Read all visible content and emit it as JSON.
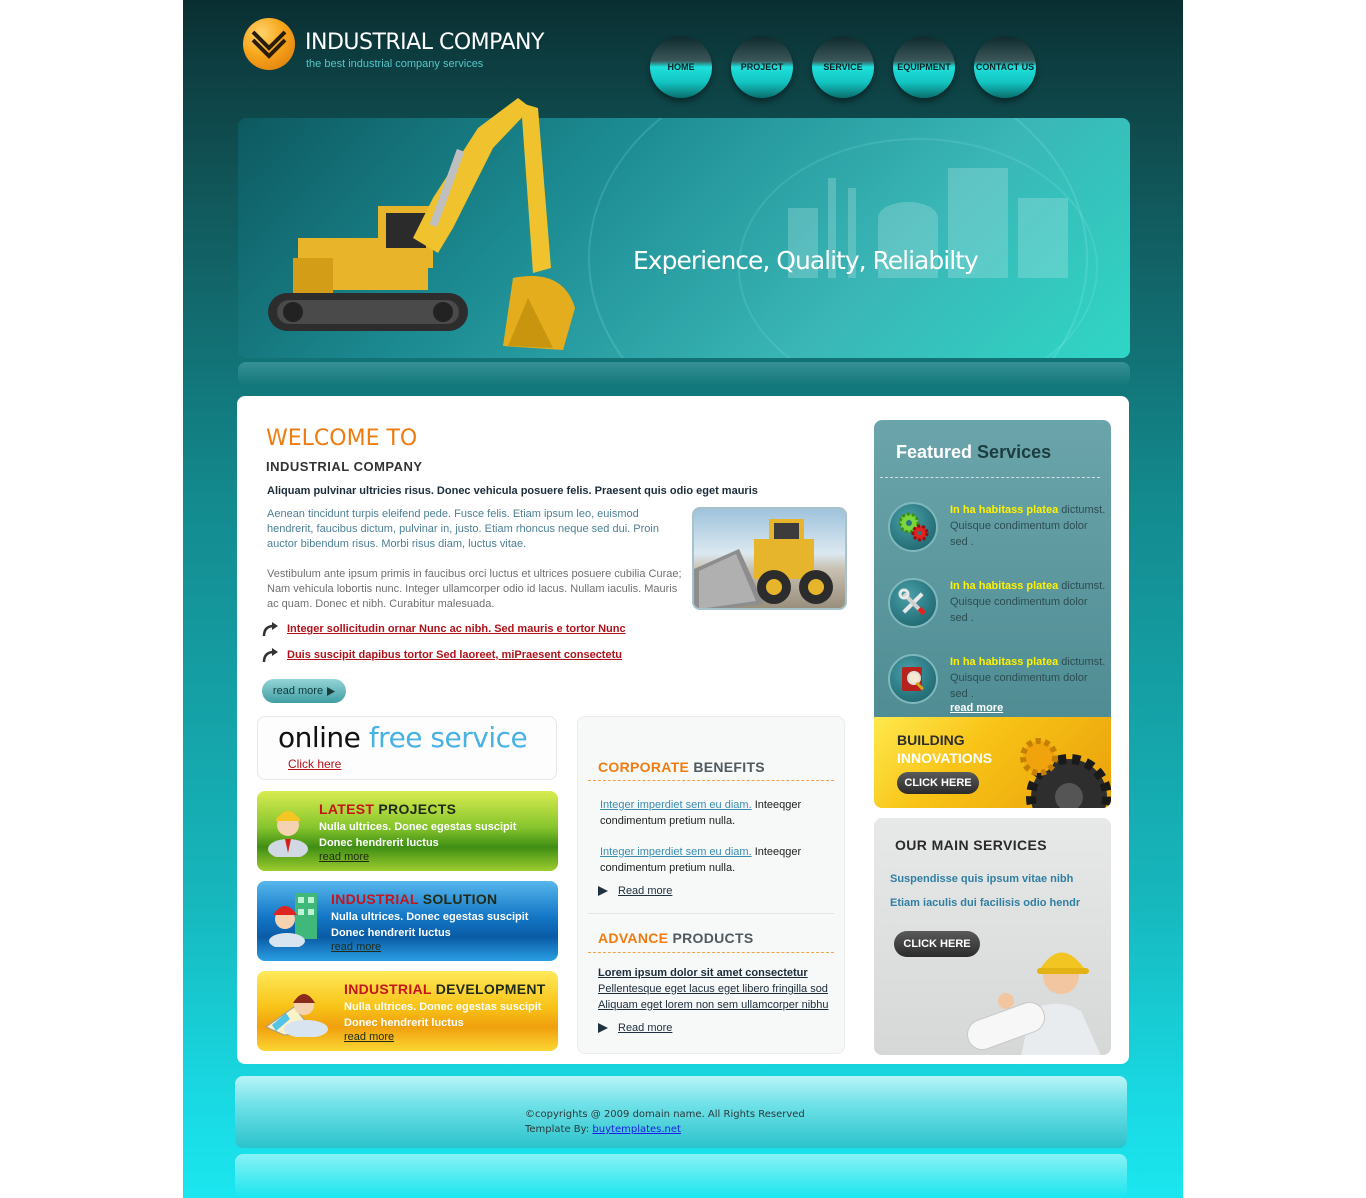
{
  "header": {
    "title": "INDUSTRIAL COMPANY",
    "tagline": "the best industrial  company services"
  },
  "nav": [
    {
      "label": "HOME"
    },
    {
      "label": "PROJECT"
    },
    {
      "label": "SERVICE"
    },
    {
      "label": "EQUIPMENT"
    },
    {
      "label": "CONTACT US"
    }
  ],
  "banner": {
    "slogan": "Experience, Quality, Reliabilty"
  },
  "welcome": {
    "heading": "WELCOME TO",
    "subheading": "INDUSTRIAL COMPANY",
    "intro": "Aliquam pulvinar ultricies risus. Donec vehicula posuere felis. Praesent quis odio eget mauris",
    "para1": "Aenean tincidunt turpis eleifend pede. Fusce felis. Etiam ipsum leo, euismod hendrerit, faucibus dictum, pulvinar in, justo. Etiam rhoncus neque sed dui. Proin auctor bibendum risus. Morbi risus diam, luctus vitae.",
    "para2": "Vestibulum ante ipsum primis in faucibus orci luctus et ultrices posuere cubilia Curae; Nam vehicula lobortis nunc. Integer ullamcorper odio id lacus. Nullam iaculis. Mauris ac quam. Donec et nibh. Curabitur malesuada.",
    "links": [
      "Integer sollicitudin ornar Nunc ac nibh. Sed mauris e tortor Nunc",
      "Duis suscipit dapibus tortor Sed laoreet, miPraesent consectetu"
    ],
    "read_more": "read more"
  },
  "online": {
    "title_dark": "online",
    "title_light": "free service",
    "link": "Click here"
  },
  "promos": [
    {
      "title_red": "LATEST",
      "title_dark": "PROJECTS",
      "line1": "Nulla ultrices. Donec egestas suscipit",
      "line2": "Donec hendrerit luctus",
      "more": "read more"
    },
    {
      "title_red": "INDUSTRIAL",
      "title_dark": "SOLUTION",
      "line1": "Nulla ultrices. Donec egestas suscipit",
      "line2": "Donec hendrerit luctus",
      "more": "read more"
    },
    {
      "title_red": "INDUSTRIAL",
      "title_dark": "DEVELOPMENT",
      "line1": "Nulla ultrices. Donec egestas suscipit",
      "line2": "Donec hendrerit luctus",
      "more": "read more"
    }
  ],
  "corporate": {
    "title_orange": "CORPORATE",
    "title_grey": "BENEFITS",
    "items": [
      {
        "link": "Integer imperdiet sem eu diam.",
        "text": " Inteeqger condimentum pretium nulla."
      },
      {
        "link": "Integer imperdiet sem eu diam.",
        "text": " Inteeqger condimentum pretium nulla."
      }
    ],
    "read_more": "Read more"
  },
  "advance": {
    "title_orange": "ADVANCE",
    "title_grey": "PRODUCTS",
    "lines": [
      "Lorem ipsum dolor sit amet consectetur",
      "Pellentesque eget lacus eget libero fringilla sod",
      "Aliquam eget lorem non sem ullamcorper nibhu"
    ],
    "read_more": "Read more"
  },
  "featured": {
    "title_white": "Featured",
    "title_dark": "Services",
    "items": [
      {
        "highlight": "In ha habitass platea",
        "rest": " dictumst. Quisque condimentum dolor sed .",
        "icon": "gears-icon"
      },
      {
        "highlight": "In ha habitass platea",
        "rest": " dictumst. Quisque condimentum dolor sed .",
        "icon": "tools-icon"
      },
      {
        "highlight": "In ha habitass platea",
        "rest": " dictumst. Quisque condimentum dolor sed .",
        "icon": "book-search-icon"
      }
    ],
    "read_more": "read more"
  },
  "building": {
    "line1": "BUILDING",
    "line2": "INNOVATIONS",
    "button": "CLICK HERE"
  },
  "main_services": {
    "title": "OUR MAIN SERVICES",
    "items": [
      "Suspendisse quis ipsum vitae nibh",
      "Etiam iaculis dui facilisis odio hendr"
    ],
    "button": "CLICK HERE"
  },
  "footer": {
    "copyright": "©copyrights @ 2009 domain name. All Rights Reserved",
    "template_prefix": "Template By: ",
    "template_link": "buytemplates.net"
  },
  "colors": {
    "accent_orange": "#f07c0f",
    "link_red": "#b0121a",
    "teal": "#138a8e",
    "featured_yellow": "#fff200"
  }
}
